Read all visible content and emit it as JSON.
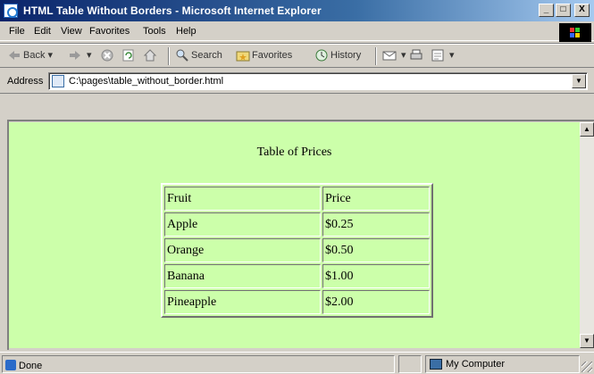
{
  "window": {
    "title": "HTML Table Without Borders - Microsoft Internet Explorer",
    "controls": {
      "minimize": "_",
      "maximize": "□",
      "close": "X"
    }
  },
  "menu": {
    "items": [
      "File",
      "Edit",
      "View",
      "Favorites",
      "Tools",
      "Help"
    ]
  },
  "toolbar": {
    "back": "Back",
    "forward": "→",
    "stop": "stop-icon",
    "refresh": "refresh-icon",
    "home": "home-icon",
    "search": "Search",
    "favorites": "Favorites",
    "history": "History",
    "mail": "mail-icon",
    "print": "print-icon",
    "edit": "edit-icon"
  },
  "address": {
    "label": "Address",
    "url": "C:\\pages\\table_without_border.html"
  },
  "page": {
    "background": "#ccffaa",
    "caption": "Table of Prices",
    "table": {
      "headers": [
        "Fruit",
        "Price"
      ],
      "rows": [
        [
          "Apple",
          "$0.25"
        ],
        [
          "Orange",
          "$0.50"
        ],
        [
          "Banana",
          "$1.00"
        ],
        [
          "Pineapple",
          "$2.00"
        ]
      ]
    }
  },
  "status": {
    "text": "Done",
    "zone": "My Computer"
  },
  "colors": {
    "titlebar": "#0a246a",
    "chrome": "#d4d0c8",
    "page_bg": "#ccffaa"
  }
}
